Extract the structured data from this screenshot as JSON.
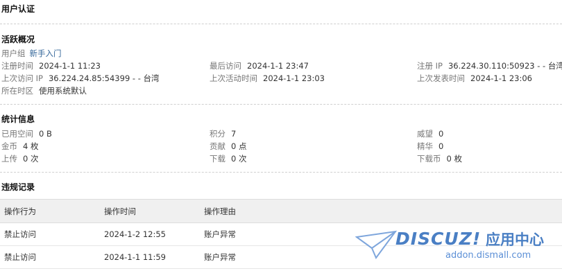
{
  "page_title": "用户认证",
  "activity": {
    "title": "活跃概况",
    "usergroup_label": "用户组",
    "usergroup_value": "新手入门",
    "rows": [
      [
        {
          "label": "注册时间",
          "value": "2024-1-1 11:23"
        },
        {
          "label": "最后访问",
          "value": "2024-1-1 23:47"
        },
        {
          "label": "注册 IP",
          "value": "36.224.30.110:50923 - - 台湾"
        }
      ],
      [
        {
          "label": "上次访问 IP",
          "value": "36.224.24.85:54399 - - 台湾"
        },
        {
          "label": "上次活动时间",
          "value": "2024-1-1 23:03"
        },
        {
          "label": "上次发表时间",
          "value": "2024-1-1 23:06"
        }
      ],
      [
        {
          "label": "所在时区",
          "value": "使用系统默认"
        }
      ]
    ]
  },
  "stats": {
    "title": "统计信息",
    "rows": [
      [
        {
          "label": "已用空间",
          "value": "0 B"
        },
        {
          "label": "积分",
          "value": "7"
        },
        {
          "label": "威望",
          "value": "0"
        }
      ],
      [
        {
          "label": "金币",
          "value": "4 枚"
        },
        {
          "label": "贡献",
          "value": "0 点"
        },
        {
          "label": "精华",
          "value": "0"
        }
      ],
      [
        {
          "label": "上传",
          "value": "0 次"
        },
        {
          "label": "下载",
          "value": "0 次"
        },
        {
          "label": "下载币",
          "value": "0 枚"
        }
      ]
    ]
  },
  "violations": {
    "title": "违规记录",
    "headers": [
      "操作行为",
      "操作时间",
      "操作理由"
    ],
    "rows": [
      [
        "禁止访问",
        "2024-1-2 12:55",
        "账户异常"
      ],
      [
        "禁止访问",
        "2024-1-1 11:59",
        "账户异常"
      ]
    ]
  },
  "watermark": {
    "brand": "DISCUZ!",
    "cn": "应用中心",
    "url": "addon.dismall.com"
  }
}
